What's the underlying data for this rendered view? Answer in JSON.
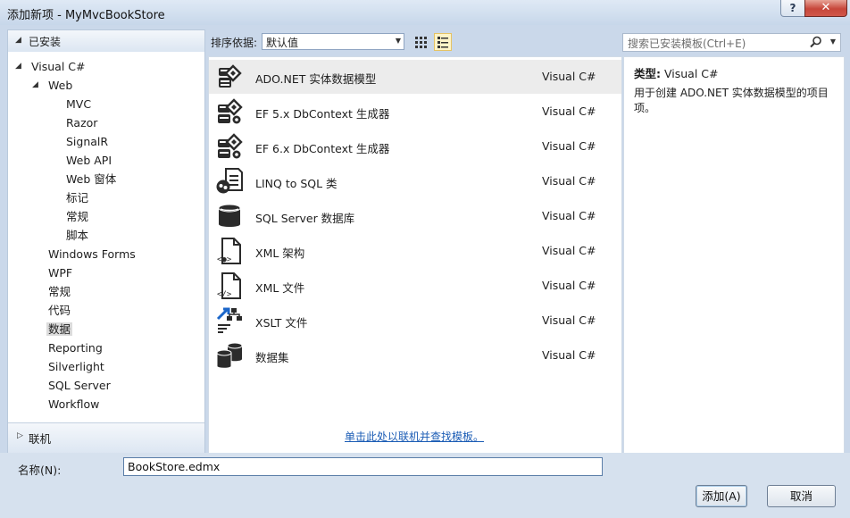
{
  "window": {
    "title": "添加新项 - MyMvcBookStore",
    "help_label": "?",
    "close_label": "✕"
  },
  "left_panel": {
    "header": "已安装",
    "tree": [
      {
        "label": "Visual C#",
        "level": 0,
        "expanded": true
      },
      {
        "label": "Web",
        "level": 1,
        "expanded": true
      },
      {
        "label": "MVC",
        "level": 2
      },
      {
        "label": "Razor",
        "level": 2
      },
      {
        "label": "SignalR",
        "level": 2
      },
      {
        "label": "Web API",
        "level": 2
      },
      {
        "label": "Web 窗体",
        "level": 2
      },
      {
        "label": "标记",
        "level": 2
      },
      {
        "label": "常规",
        "level": 2
      },
      {
        "label": "脚本",
        "level": 2
      },
      {
        "label": "Windows Forms",
        "level": 1
      },
      {
        "label": "WPF",
        "level": 1
      },
      {
        "label": "常规",
        "level": 1
      },
      {
        "label": "代码",
        "level": 1
      },
      {
        "label": "数据",
        "level": 1,
        "selected": true
      },
      {
        "label": "Reporting",
        "level": 1
      },
      {
        "label": "Silverlight",
        "level": 1
      },
      {
        "label": "SQL Server",
        "level": 1
      },
      {
        "label": "Workflow",
        "level": 1
      }
    ],
    "footer": "联机"
  },
  "toolbar": {
    "sort_label": "排序依据:",
    "sort_value": "默认值",
    "search_placeholder": "搜索已安装模板(Ctrl+E)"
  },
  "items": [
    {
      "name": "ADO.NET 实体数据模型",
      "lang": "Visual C#",
      "icon": "entity-model-icon",
      "selected": true
    },
    {
      "name": "EF 5.x DbContext 生成器",
      "lang": "Visual C#",
      "icon": "dbcontext-generator-icon"
    },
    {
      "name": "EF 6.x DbContext 生成器",
      "lang": "Visual C#",
      "icon": "dbcontext-generator-icon"
    },
    {
      "name": "LINQ to SQL 类",
      "lang": "Visual C#",
      "icon": "linq-to-sql-icon"
    },
    {
      "name": "SQL Server 数据库",
      "lang": "Visual C#",
      "icon": "database-icon"
    },
    {
      "name": "XML 架构",
      "lang": "Visual C#",
      "icon": "xml-schema-icon"
    },
    {
      "name": "XML 文件",
      "lang": "Visual C#",
      "icon": "xml-file-icon"
    },
    {
      "name": "XSLT 文件",
      "lang": "Visual C#",
      "icon": "xslt-file-icon"
    },
    {
      "name": "数据集",
      "lang": "Visual C#",
      "icon": "dataset-icon"
    }
  ],
  "online_link": "单击此处以联机并查找模板。",
  "details": {
    "type_key": "类型:",
    "type_value": "Visual C#",
    "description": "用于创建 ADO.NET 实体数据模型的项目项。"
  },
  "bottom": {
    "name_label": "名称(N):",
    "name_value": "BookStore.edmx",
    "add_label": "添加(A)",
    "cancel_label": "取消"
  },
  "colors": {
    "accent": "#1b5cb5",
    "selection": "#ececec",
    "panel_bg": "#cad8ea"
  }
}
